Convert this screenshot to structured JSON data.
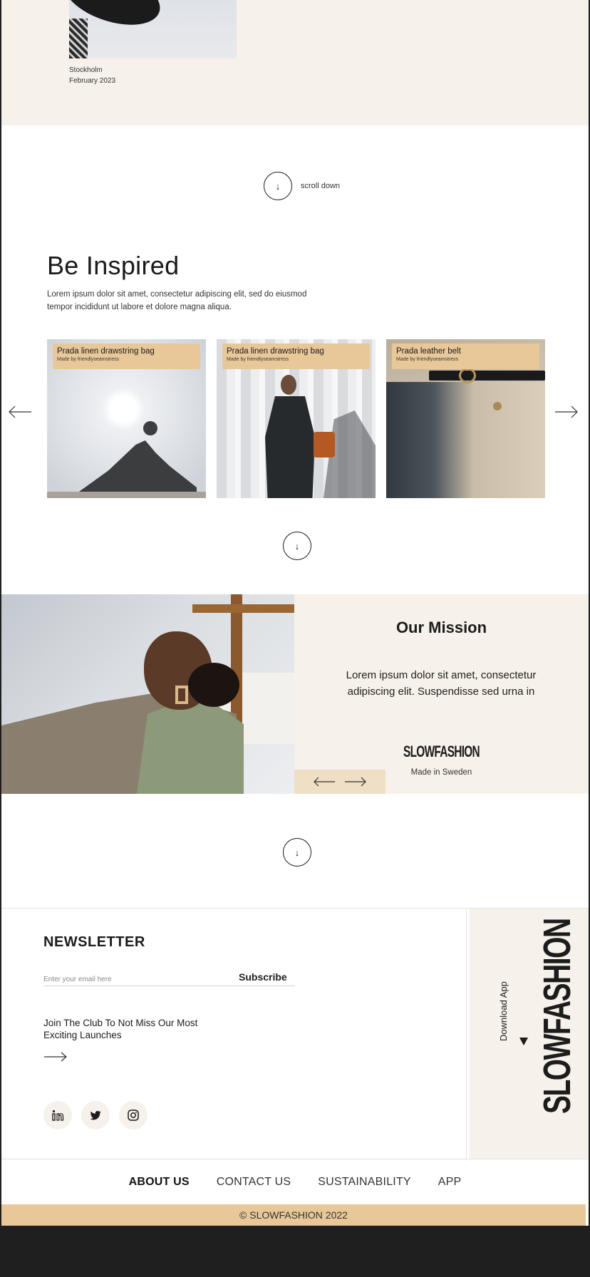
{
  "top": {
    "caption_city": "Stockholm",
    "caption_date": "February 2023"
  },
  "scroll": {
    "label": "scroll down",
    "icon": "arrow-down-icon"
  },
  "inspired": {
    "title": "Be Inspired",
    "text": "Lorem ipsum dolor sit amet, consectetur adipiscing elit, sed do eiusmod tempor incididunt ut labore et dolore magna aliqua.",
    "cards": [
      {
        "title": "Prada linen drawstring bag",
        "sub": "Made by friendlyseamstress"
      },
      {
        "title": "Prada linen drawstring bag",
        "sub": "Made by friendlyseamstress"
      },
      {
        "title": "Prada leather belt",
        "sub": "Made by friendlyseamstress"
      }
    ]
  },
  "mission": {
    "title": "Our Mission",
    "text": "Lorem ipsum dolor sit amet, consectetur adipiscing elit. Suspendisse sed urna in",
    "brand": "SLOWFASHION",
    "made": "Made in Sweden"
  },
  "newsletter": {
    "title": "NEWSLETTER",
    "placeholder": "Enter your email here",
    "subscribe": "Subscribe",
    "join": "Join The Club To Not Miss Our Most Exciting Launches",
    "social": [
      "linkedin-icon",
      "twitter-icon",
      "instagram-icon"
    ]
  },
  "app": {
    "download": "Download App",
    "brand": "SLOWFASHION"
  },
  "footer": {
    "links": [
      "ABOUT US",
      "CONTACT US",
      "SUSTAINABILITY",
      "APP"
    ],
    "copyright": "© SLOWFASHION 2022"
  },
  "colors": {
    "beige_bg": "#f6f1ea",
    "accent_tan": "#e8c898",
    "text": "#1c1c1c"
  }
}
